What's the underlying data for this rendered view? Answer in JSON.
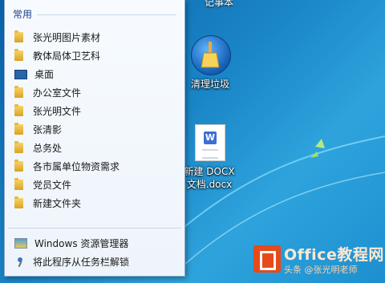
{
  "jumplist": {
    "header": "常用",
    "items": [
      {
        "label": "张光明图片素材",
        "icon": "folder-icon"
      },
      {
        "label": "教体局体卫艺科",
        "icon": "folder-icon"
      },
      {
        "label": "桌面",
        "icon": "desktop-icon"
      },
      {
        "label": "办公室文件",
        "icon": "folder-icon"
      },
      {
        "label": "张光明文件",
        "icon": "folder-icon"
      },
      {
        "label": "张清影",
        "icon": "folder-icon"
      },
      {
        "label": "总务处",
        "icon": "folder-icon"
      },
      {
        "label": "各市属单位物资需求",
        "icon": "folder-icon"
      },
      {
        "label": "党员文件",
        "icon": "folder-icon"
      },
      {
        "label": "新建文件夹",
        "icon": "folder-icon"
      }
    ],
    "footer": {
      "explorer_label": "Windows 资源管理器",
      "unpin_label": "将此程序从任务栏解锁"
    }
  },
  "desktop": {
    "top_label": "记事本",
    "recycle_label": "清理垃圾",
    "doc_label_line1": "新建 DOCX",
    "doc_label_line2": "文档.docx",
    "doc_badge": "W"
  },
  "watermark": {
    "title": "Office教程网",
    "subtitle": "头条 @张光明老师"
  }
}
